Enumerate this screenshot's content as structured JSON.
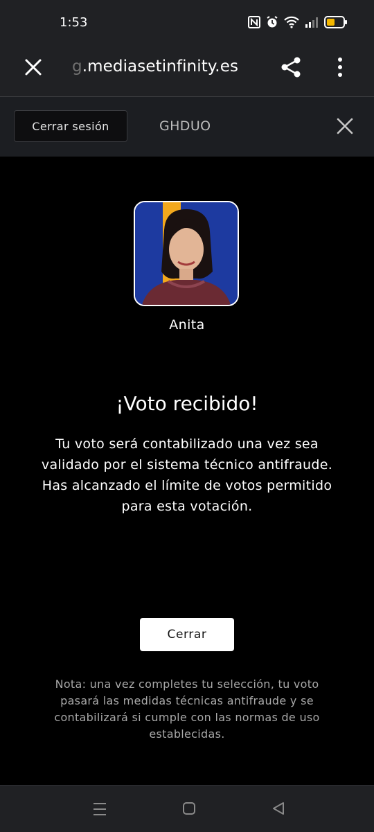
{
  "status_bar": {
    "time": "1:53",
    "icons": [
      "nfc-icon",
      "alarm-icon",
      "wifi-icon",
      "signal-icon",
      "battery-icon"
    ],
    "battery_color": "#f5b800"
  },
  "browser": {
    "url_prefix": "g",
    "url_domain": ".mediasetinfinity.es"
  },
  "site_header": {
    "logout_label": "Cerrar sesión",
    "user_code": "GHDUO"
  },
  "candidate": {
    "name": "Anita"
  },
  "result": {
    "title": "¡Voto recibido!",
    "message": "Tu voto será contabilizado una vez sea validado por el sistema técnico antifraude. Has alcanzado el límite de votos permitido para esta votación."
  },
  "actions": {
    "close_label": "Cerrar"
  },
  "note": "Nota: una vez completes tu selección, tu voto pasará las medidas técnicas antifraude y se contabilizará si cumple con las normas de uso establecidas.",
  "colors": {
    "background": "#000000",
    "chrome": "#202124",
    "header": "#1c1e22",
    "avatar_bg": "#1d3aa0",
    "avatar_stripe": "#f2a81d"
  }
}
